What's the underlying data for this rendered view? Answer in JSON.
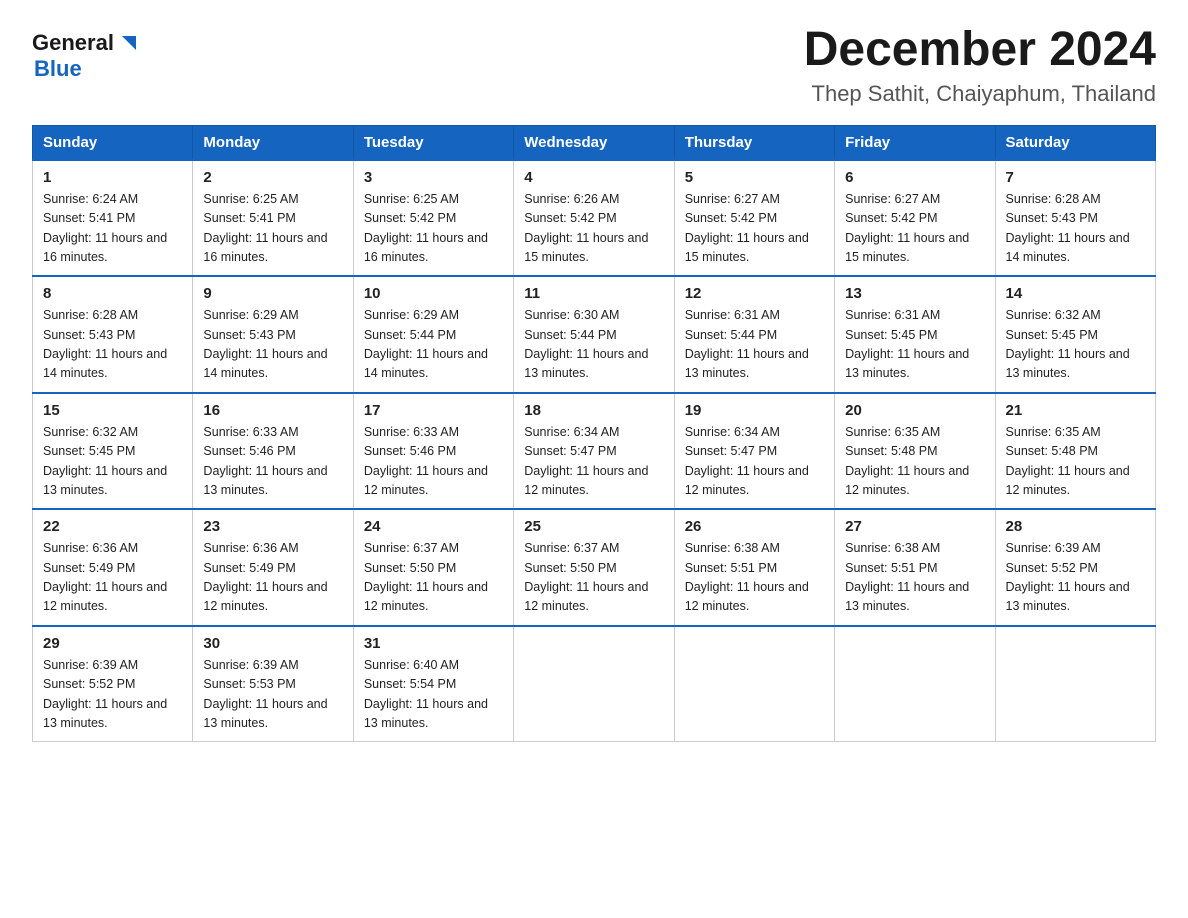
{
  "header": {
    "logo_general": "General",
    "logo_blue": "Blue",
    "month_year": "December 2024",
    "location": "Thep Sathit, Chaiyaphum, Thailand"
  },
  "weekdays": [
    "Sunday",
    "Monday",
    "Tuesday",
    "Wednesday",
    "Thursday",
    "Friday",
    "Saturday"
  ],
  "weeks": [
    [
      {
        "day": "1",
        "sunrise": "6:24 AM",
        "sunset": "5:41 PM",
        "daylight": "11 hours and 16 minutes."
      },
      {
        "day": "2",
        "sunrise": "6:25 AM",
        "sunset": "5:41 PM",
        "daylight": "11 hours and 16 minutes."
      },
      {
        "day": "3",
        "sunrise": "6:25 AM",
        "sunset": "5:42 PM",
        "daylight": "11 hours and 16 minutes."
      },
      {
        "day": "4",
        "sunrise": "6:26 AM",
        "sunset": "5:42 PM",
        "daylight": "11 hours and 15 minutes."
      },
      {
        "day": "5",
        "sunrise": "6:27 AM",
        "sunset": "5:42 PM",
        "daylight": "11 hours and 15 minutes."
      },
      {
        "day": "6",
        "sunrise": "6:27 AM",
        "sunset": "5:42 PM",
        "daylight": "11 hours and 15 minutes."
      },
      {
        "day": "7",
        "sunrise": "6:28 AM",
        "sunset": "5:43 PM",
        "daylight": "11 hours and 14 minutes."
      }
    ],
    [
      {
        "day": "8",
        "sunrise": "6:28 AM",
        "sunset": "5:43 PM",
        "daylight": "11 hours and 14 minutes."
      },
      {
        "day": "9",
        "sunrise": "6:29 AM",
        "sunset": "5:43 PM",
        "daylight": "11 hours and 14 minutes."
      },
      {
        "day": "10",
        "sunrise": "6:29 AM",
        "sunset": "5:44 PM",
        "daylight": "11 hours and 14 minutes."
      },
      {
        "day": "11",
        "sunrise": "6:30 AM",
        "sunset": "5:44 PM",
        "daylight": "11 hours and 13 minutes."
      },
      {
        "day": "12",
        "sunrise": "6:31 AM",
        "sunset": "5:44 PM",
        "daylight": "11 hours and 13 minutes."
      },
      {
        "day": "13",
        "sunrise": "6:31 AM",
        "sunset": "5:45 PM",
        "daylight": "11 hours and 13 minutes."
      },
      {
        "day": "14",
        "sunrise": "6:32 AM",
        "sunset": "5:45 PM",
        "daylight": "11 hours and 13 minutes."
      }
    ],
    [
      {
        "day": "15",
        "sunrise": "6:32 AM",
        "sunset": "5:45 PM",
        "daylight": "11 hours and 13 minutes."
      },
      {
        "day": "16",
        "sunrise": "6:33 AM",
        "sunset": "5:46 PM",
        "daylight": "11 hours and 13 minutes."
      },
      {
        "day": "17",
        "sunrise": "6:33 AM",
        "sunset": "5:46 PM",
        "daylight": "11 hours and 12 minutes."
      },
      {
        "day": "18",
        "sunrise": "6:34 AM",
        "sunset": "5:47 PM",
        "daylight": "11 hours and 12 minutes."
      },
      {
        "day": "19",
        "sunrise": "6:34 AM",
        "sunset": "5:47 PM",
        "daylight": "11 hours and 12 minutes."
      },
      {
        "day": "20",
        "sunrise": "6:35 AM",
        "sunset": "5:48 PM",
        "daylight": "11 hours and 12 minutes."
      },
      {
        "day": "21",
        "sunrise": "6:35 AM",
        "sunset": "5:48 PM",
        "daylight": "11 hours and 12 minutes."
      }
    ],
    [
      {
        "day": "22",
        "sunrise": "6:36 AM",
        "sunset": "5:49 PM",
        "daylight": "11 hours and 12 minutes."
      },
      {
        "day": "23",
        "sunrise": "6:36 AM",
        "sunset": "5:49 PM",
        "daylight": "11 hours and 12 minutes."
      },
      {
        "day": "24",
        "sunrise": "6:37 AM",
        "sunset": "5:50 PM",
        "daylight": "11 hours and 12 minutes."
      },
      {
        "day": "25",
        "sunrise": "6:37 AM",
        "sunset": "5:50 PM",
        "daylight": "11 hours and 12 minutes."
      },
      {
        "day": "26",
        "sunrise": "6:38 AM",
        "sunset": "5:51 PM",
        "daylight": "11 hours and 12 minutes."
      },
      {
        "day": "27",
        "sunrise": "6:38 AM",
        "sunset": "5:51 PM",
        "daylight": "11 hours and 13 minutes."
      },
      {
        "day": "28",
        "sunrise": "6:39 AM",
        "sunset": "5:52 PM",
        "daylight": "11 hours and 13 minutes."
      }
    ],
    [
      {
        "day": "29",
        "sunrise": "6:39 AM",
        "sunset": "5:52 PM",
        "daylight": "11 hours and 13 minutes."
      },
      {
        "day": "30",
        "sunrise": "6:39 AM",
        "sunset": "5:53 PM",
        "daylight": "11 hours and 13 minutes."
      },
      {
        "day": "31",
        "sunrise": "6:40 AM",
        "sunset": "5:54 PM",
        "daylight": "11 hours and 13 minutes."
      },
      null,
      null,
      null,
      null
    ]
  ]
}
